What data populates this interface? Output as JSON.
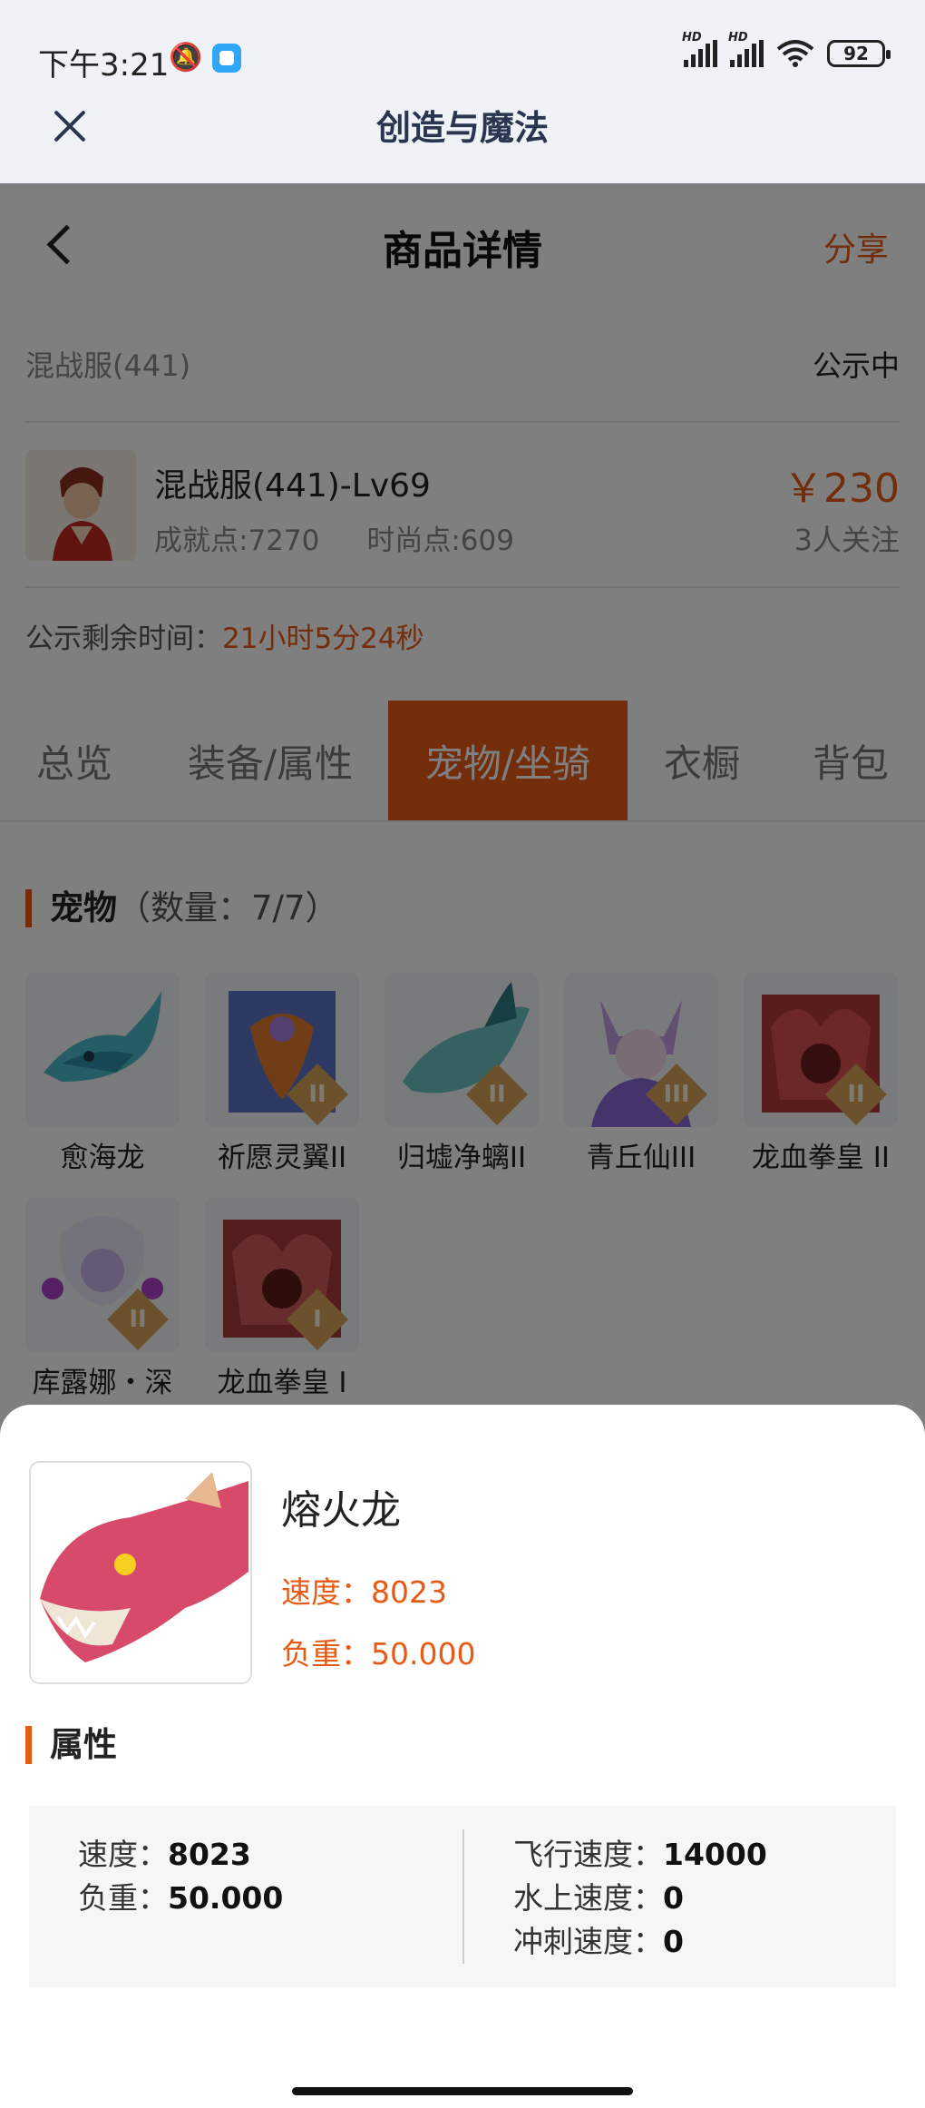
{
  "status_bar": {
    "time": "下午3:21",
    "hd1": "HD",
    "hd2": "HD",
    "battery": "92"
  },
  "top_bar": {
    "title": "创造与魔法"
  },
  "nav": {
    "title": "商品详情",
    "share": "分享"
  },
  "listing": {
    "server": "混战服(441)",
    "status": "公示中",
    "character_name": "混战服(441)-Lv69",
    "achievement": "成就点:7270",
    "fashion": "时尚点:609",
    "price": "￥230",
    "followers": "3人关注",
    "timer_label": "公示剩余时间：",
    "timer_value": "21小时5分24秒"
  },
  "tabs": [
    "总览",
    "装备/属性",
    "宠物/坐骑",
    "衣橱",
    "背包"
  ],
  "active_tab": "宠物/坐骑",
  "pets_section": {
    "title": "宠物",
    "count": "（数量：7/7）"
  },
  "pets": [
    {
      "name": "愈海龙",
      "tier": ""
    },
    {
      "name": "祈愿灵翼II",
      "tier": "II"
    },
    {
      "name": "归墟净螭II",
      "tier": "II"
    },
    {
      "name": "青丘仙III",
      "tier": "III"
    },
    {
      "name": "龙血拳皇 II",
      "tier": "II"
    },
    {
      "name": "库露娜・深",
      "tier": "II"
    },
    {
      "name": "龙血拳皇 I",
      "tier": "I"
    }
  ],
  "detail": {
    "name": "熔火龙",
    "speed": "速度：8023",
    "load": "负重：50.000",
    "attr_title": "属性",
    "attrs_left": [
      {
        "label": "速度：",
        "value": "8023"
      },
      {
        "label": "负重：",
        "value": "50.000"
      }
    ],
    "attrs_right": [
      {
        "label": "飞行速度：",
        "value": "14000"
      },
      {
        "label": "水上速度：",
        "value": "0"
      },
      {
        "label": "冲刺速度：",
        "value": "0"
      }
    ]
  },
  "colors": {
    "accent": "#e65a14",
    "topbar_bg": "#eff3f8",
    "title": "#2a3550"
  }
}
